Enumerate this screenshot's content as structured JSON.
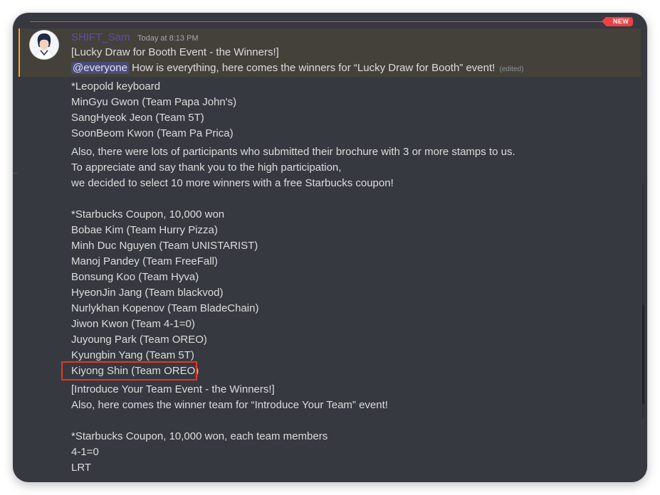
{
  "badge": {
    "new": "NEW"
  },
  "message": {
    "author": "SHIFT_Sam",
    "timestamp": "Today at 8:13 PM",
    "title": "[Lucky Draw for Booth Event - the Winners!]",
    "mention": "@everyone",
    "intro": "How is everything, here comes the winners for “Lucky Draw for Booth” event!",
    "edited": "(edited)",
    "lines": [
      "*Leopold keyboard",
      "MinGyu Gwon (Team Papa John's)",
      "SangHyeok Jeon (Team 5T)",
      "SoonBeom Kwon (Team Pa Prica)",
      "Also, there were lots of participants who submitted their brochure with 3 or more stamps to us.",
      "To appreciate and say thank you to the high participation,",
      "we decided to select 10 more winners with a free Starbucks coupon!",
      "*Starbucks Coupon, 10,000 won",
      "Bobae Kim (Team Hurry Pizza)",
      "Minh Duc Nguyen (Team UNISTARIST)",
      "Manoj Pandey (Team FreeFall)",
      "Bonsung Koo (Team Hyva)",
      "HyeonJin Jang (Team blackvod)",
      "Nurlykhan Kopenov (Team BladeChain)",
      "Jiwon Kwon (Team 4-1=0)",
      "Juyoung Park (Team OREO)",
      "Kyungbin Yang (Team 5T)",
      "Kiyong Shin (Team OREO)",
      "[Introduce Your Team Event - the Winners!]",
      "Also, here comes the winner team for “Introduce Your Team” event!",
      "*Starbucks Coupon, 10,000 won, each team members",
      "4-1=0",
      "LRT"
    ]
  },
  "colors": {
    "background": "#36393f",
    "text": "#dcddde",
    "highlight": "#44413b",
    "highlight_border": "#faa61a",
    "new_badge": "#ed4245",
    "annotation_box": "#e53626"
  }
}
